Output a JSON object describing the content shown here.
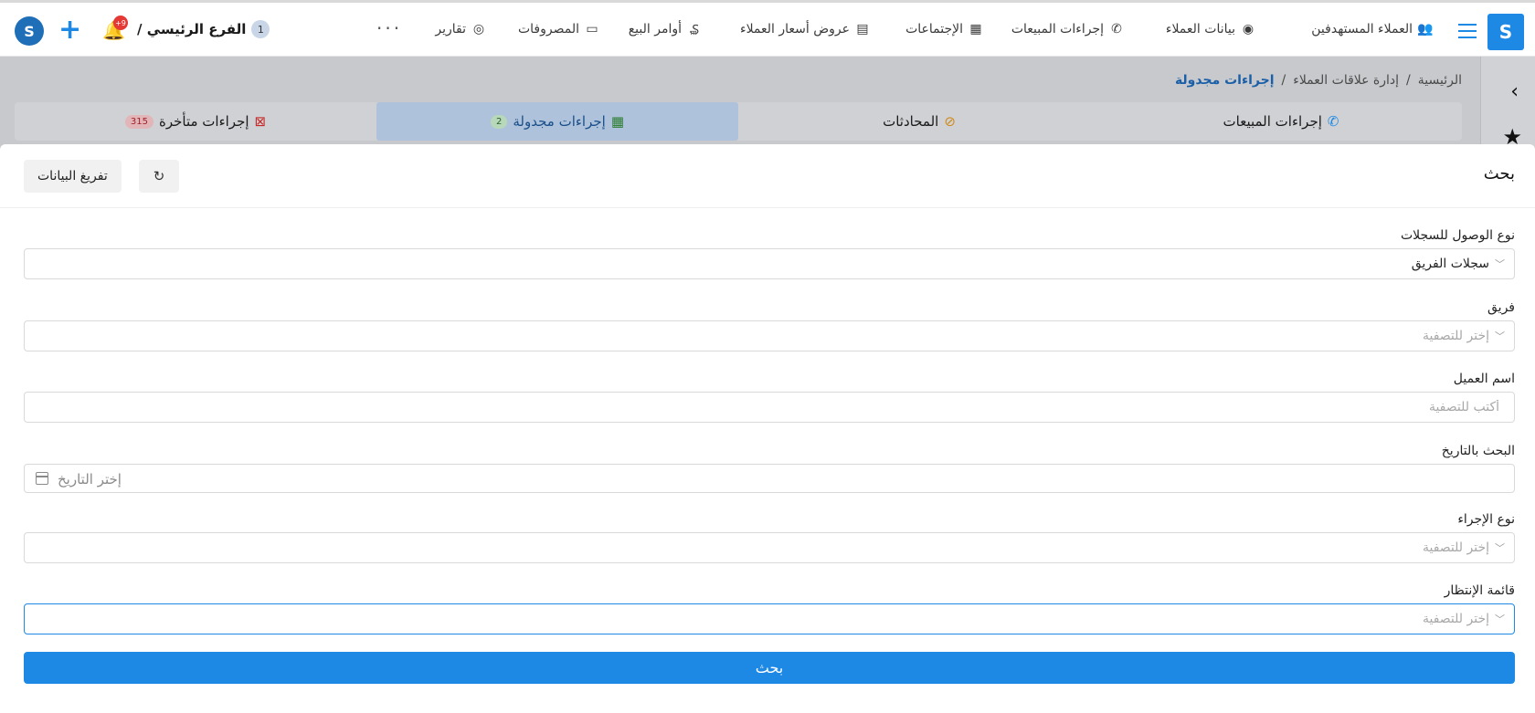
{
  "nav": {
    "items": [
      {
        "label": "العملاء المستهدفين",
        "icon": "target-customers-icon"
      },
      {
        "label": "بيانات العملاء",
        "icon": "customer-data-icon"
      },
      {
        "label": "إجراءات المبيعات",
        "icon": "phone-icon"
      },
      {
        "label": "الإجتماعات",
        "icon": "presentation-icon"
      },
      {
        "label": "عروض أسعار العملاء",
        "icon": "quote-document-icon"
      },
      {
        "label": "أوامر البيع",
        "icon": "money-bag-icon"
      },
      {
        "label": "المصروفات",
        "icon": "laptop-icon"
      },
      {
        "label": "تقارير",
        "icon": "report-icon"
      }
    ],
    "more": "···",
    "branch": "الفرع الرئيسي /",
    "branch_num": "1",
    "notif_badge": "+9"
  },
  "breadcrumb": {
    "home": "الرئيسية",
    "sep": "/",
    "section": "إدارة علاقات العملاء",
    "current": "إجراءات مجدولة"
  },
  "tabs": [
    {
      "label": "إجراءات المبيعات",
      "count": null
    },
    {
      "label": "المحادثات",
      "count": null
    },
    {
      "label": "إجراءات مجدولة",
      "count": "2"
    },
    {
      "label": "إجراءات متأخرة",
      "count": "315"
    }
  ],
  "search": {
    "title": "بحث",
    "clear_label": "تفريغ البيانات",
    "access_label": "نوع الوصول للسجلات",
    "access_value": "سجلات الفريق",
    "team_label": "فريق",
    "team_placeholder": "إختر للتصفية",
    "customer_label": "اسم العميل",
    "customer_placeholder": "أكتب للتصفية",
    "date_label": "البحث بالتاريخ",
    "date_placeholder": "إختر التاريخ",
    "action_type_label": "نوع الإجراء",
    "action_type_placeholder": "إختر للتصفية",
    "waitlist_label": "قائمة الإنتظار",
    "waitlist_placeholder": "إختر للتصفية",
    "submit_label": "بحث"
  },
  "colors": {
    "accent": "#1e88e5",
    "active_tab": "#aec2db",
    "badge_red": "#e53935"
  }
}
